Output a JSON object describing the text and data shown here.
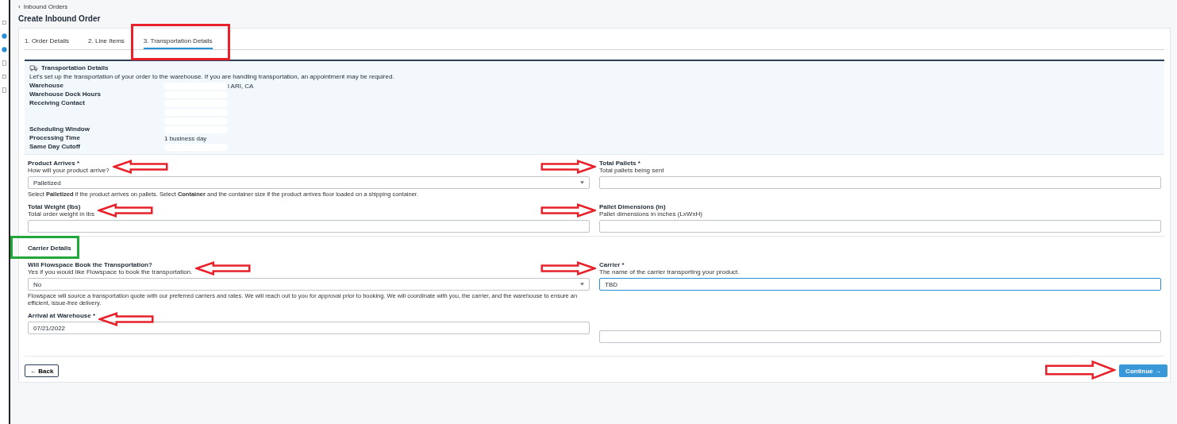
{
  "breadcrumb": {
    "icon": "‹",
    "label": "Inbound Orders"
  },
  "page_title": "Create Inbound Order",
  "tabs": [
    {
      "label": "1. Order Details",
      "selected": false
    },
    {
      "label": "2. Line Items",
      "selected": false
    },
    {
      "label": "3. Transportation Details",
      "selected": true,
      "frame": {
        "color": "#e8202a"
      }
    }
  ],
  "info_panel": {
    "title": "Transportation Details",
    "intro": "Let's set up the transportation of your order to the warehouse. If you are handling transportation, an appointment may be required.",
    "rows": [
      {
        "label": "Warehouse",
        "values": [
          {
            "text": "l ARI, CA",
            "redacted": true
          }
        ]
      },
      {
        "label": "Warehouse Dock Hours",
        "values": [
          {
            "redacted": true
          }
        ]
      },
      {
        "label": "Receiving Contact",
        "values": [
          {
            "redacted": true
          },
          {
            "redacted": true
          },
          {
            "redacted": true
          }
        ]
      },
      {
        "label": "Scheduling Window",
        "values": [
          {
            "redacted": true
          }
        ]
      },
      {
        "label": "Processing Time",
        "values": [
          {
            "text": "1 business day",
            "redacted": false
          }
        ]
      },
      {
        "label": "Same Day Cutoff",
        "values": [
          {
            "redacted": true
          }
        ]
      }
    ]
  },
  "sections": [
    {
      "fields": [
        {
          "kind": "select",
          "label": "Product Arrives *",
          "help": "How will your product arrive?",
          "value": "Palletized",
          "focused": false,
          "arrow_left": true,
          "note": "Select **Palletized** if the product arrives on pallets. Select **Container** and the container size if the product arrives floor loaded on a shipping container."
        },
        {
          "kind": "input",
          "label": "Total Pallets *",
          "help": "Total pallets being sent",
          "focused": false,
          "arrow_right": true
        },
        {
          "kind": "input",
          "label": "Total Weight (lbs)",
          "help": "Total order weight in lbs",
          "focused": false,
          "arrow_left": true
        },
        {
          "kind": "input",
          "label": "Pallet Dimensions (in)",
          "help": "Pallet dimensions in inches (LxWxH)",
          "focused": false,
          "arrow_right": true
        }
      ]
    },
    {
      "title": "Carrier Details",
      "frame": {
        "color": "#22a83a"
      },
      "fields": [
        {
          "kind": "select",
          "label": "Will Flowspace Book the Transportation?",
          "help": "Yes if you would like Flowspace to book the transportation.",
          "value": "No",
          "focused": false,
          "arrow_left": true,
          "note": "Flowspace will source a transportation quote with our preferred carriers and rates. We will reach out to you for approval prior to booking. We will coordinate with you, the carrier, and the warehouse to ensure an efficient, issue-free delivery."
        },
        {
          "kind": "input",
          "label": "Carrier *",
          "help": "The name of the carrier transporting your product.",
          "value": "TBD",
          "focused": true,
          "arrow_right": true
        },
        {
          "kind": "input",
          "label": "Arrival at Warehouse *",
          "value": "07/21/2022",
          "focused": false,
          "arrow_left": true
        },
        {
          "kind": "input",
          "focused": false
        }
      ]
    }
  ],
  "back_button": {
    "icon": "←",
    "label": "Back"
  },
  "continue_button": {
    "label": "Continue",
    "icon": "→",
    "arrow_right": true
  }
}
